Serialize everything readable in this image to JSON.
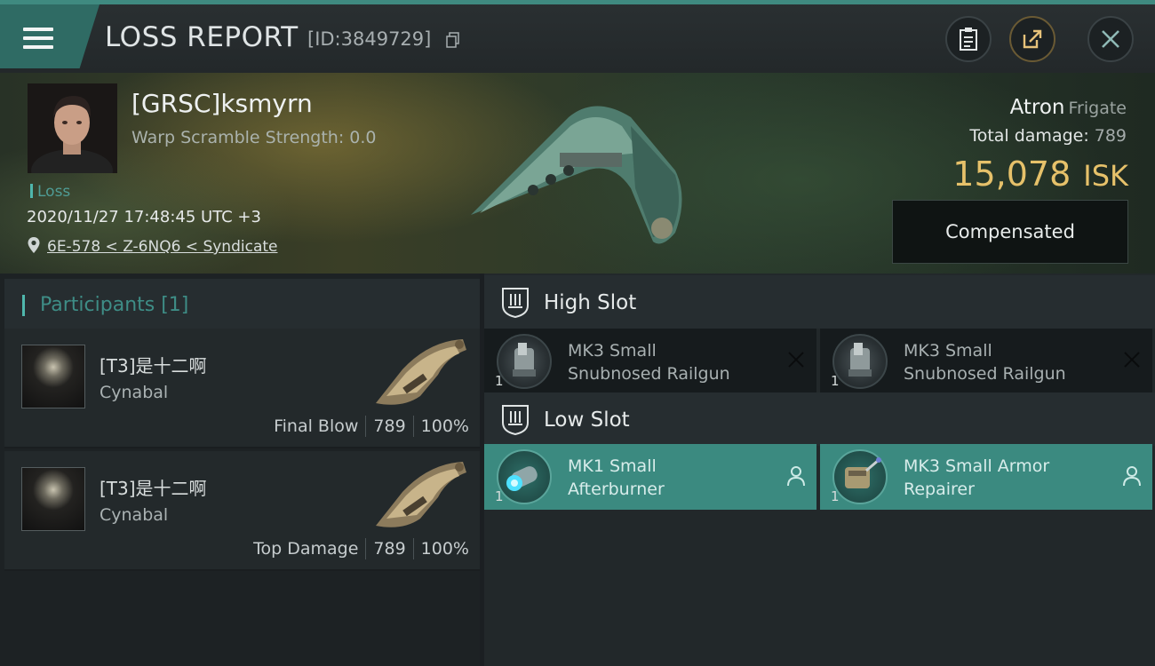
{
  "header": {
    "title": "LOSS REPORT",
    "id_label": "[ID:3849729]",
    "icons": [
      "menu-icon",
      "copy-icon",
      "clipboard-icon",
      "share-icon",
      "close-icon"
    ]
  },
  "victim": {
    "name": "[GRSC]ksmyrn",
    "warp_scramble": "Warp Scramble Strength: 0.0",
    "tag": "Loss",
    "datetime": "2020/11/27 17:48:45 UTC +3",
    "location": "6E-578 < Z-6NQ6 < Syndicate",
    "ship_name": "Atron",
    "ship_class": "Frigate",
    "total_damage_label": "Total damage:",
    "total_damage": "789",
    "isk_value": "15,078",
    "isk_unit": "ISK",
    "compensated_label": "Compensated"
  },
  "participants": {
    "title": "Participants [1]",
    "items": [
      {
        "name": "[T3]是十二啊",
        "ship": "Cynabal",
        "role": "Final Blow",
        "damage": "789",
        "percent": "100%"
      },
      {
        "name": "[T3]是十二啊",
        "ship": "Cynabal",
        "role": "Top Damage",
        "damage": "789",
        "percent": "100%"
      }
    ]
  },
  "slots": {
    "high": {
      "title": "High Slot",
      "modules": [
        {
          "qty": "1",
          "line1": "MK3 Small",
          "line2": "Snubnosed Railgun",
          "state": "destroyed"
        },
        {
          "qty": "1",
          "line1": "MK3 Small",
          "line2": "Snubnosed Railgun",
          "state": "destroyed"
        }
      ]
    },
    "low": {
      "title": "Low Slot",
      "modules": [
        {
          "qty": "1",
          "line1": "MK1 Small",
          "line2": "Afterburner",
          "state": "dropped"
        },
        {
          "qty": "1",
          "line1": "MK3 Small Armor",
          "line2": "Repairer",
          "state": "dropped"
        }
      ]
    }
  },
  "colors": {
    "accent": "#3b8a80",
    "isk": "#e6c16a",
    "panel": "#23292b"
  }
}
